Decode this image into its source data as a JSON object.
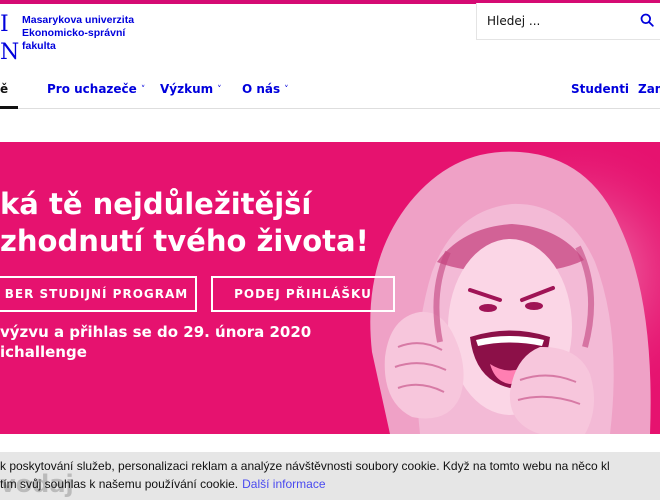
{
  "header": {
    "logo_lines": [
      "Masarykova univerzita",
      "Ekonomicko-správní",
      "fakulta"
    ],
    "logo_mark": [
      "I",
      "N"
    ],
    "search": {
      "placeholder": "Hledej ..."
    }
  },
  "nav": {
    "items": [
      {
        "label": "ě",
        "chevron": ""
      },
      {
        "label": "Pro uchazeče",
        "chevron": "˅"
      },
      {
        "label": "Výzkum",
        "chevron": "˅"
      },
      {
        "label": "O nás",
        "chevron": "˅"
      },
      {
        "label": "Studenti",
        "chevron": ""
      },
      {
        "label": "Zam",
        "chevron": ""
      }
    ]
  },
  "hero": {
    "headline": [
      "ká tě nejdůležitější",
      "zhodnutí tvého života!"
    ],
    "buttons": [
      "BER STUDIJNÍ PROGRAM",
      "PODEJ PŘIHLÁŠKU"
    ],
    "challenge": [
      "výzvu a přihlas se do 29. února 2020",
      "ichallenge"
    ]
  },
  "below": {
    "title": "vodaj"
  },
  "cookie": {
    "line1": "k poskytování služeb, personalizaci reklam a analýze návštěvnosti soubory cookie. Když na tomto webu na něco kl",
    "line2": "tím svůj souhlas k našemu používání cookie.",
    "link": "Další informace"
  },
  "colors": {
    "brand_blue": "#0000dc",
    "hero_magenta": "#e6126f",
    "top_bar": "#d50a73"
  }
}
